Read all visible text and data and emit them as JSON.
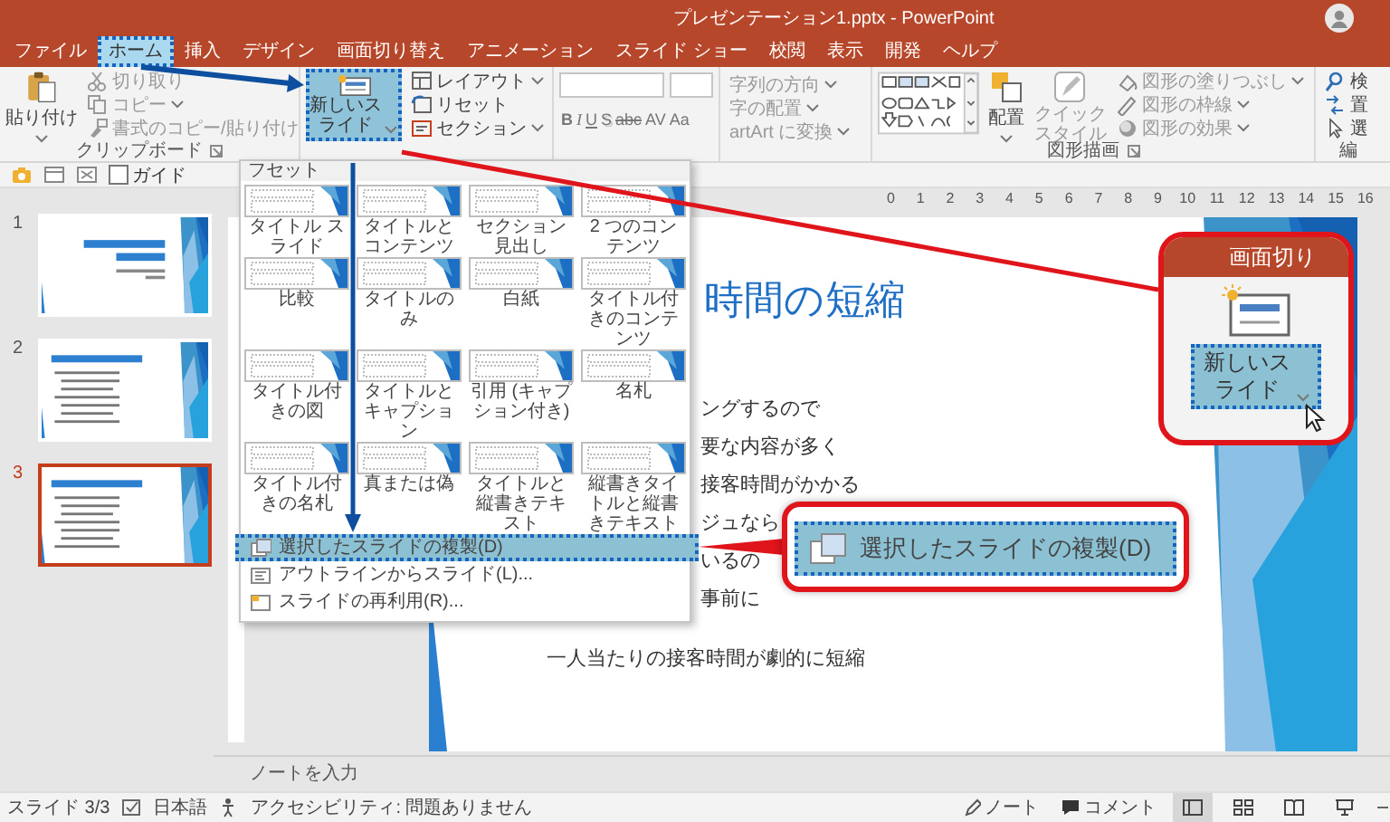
{
  "window": {
    "title": "プレゼンテーション1.pptx - PowerPoint"
  },
  "tabs": [
    {
      "label": "ファイル",
      "selected": false
    },
    {
      "label": "ホーム",
      "selected": true
    },
    {
      "label": "挿入",
      "selected": false
    },
    {
      "label": "デザイン",
      "selected": false
    },
    {
      "label": "画面切り替え",
      "selected": false
    },
    {
      "label": "アニメーション",
      "selected": false
    },
    {
      "label": "スライド ショー",
      "selected": false
    },
    {
      "label": "校閲",
      "selected": false
    },
    {
      "label": "表示",
      "selected": false
    },
    {
      "label": "開発",
      "selected": false
    },
    {
      "label": "ヘルプ",
      "selected": false
    }
  ],
  "ribbon": {
    "clipboard": {
      "paste": "貼り付け",
      "items": [
        "切り取り",
        "コピー",
        "書式のコピー/貼り付け"
      ],
      "label": "クリップボード"
    },
    "slides": {
      "new_slide": "新しいスライド",
      "items": [
        "レイアウト",
        "リセット",
        "セクション"
      ]
    },
    "font_buttons": [
      "B",
      "I",
      "U",
      "S",
      "abc",
      "AV",
      "Aa"
    ],
    "paragraph_items": [
      "字列の方向",
      "字の配置",
      "artArt に変換"
    ],
    "drawing": {
      "arrange": "配置",
      "quick_styles": "クイックスタイル",
      "items": [
        "図形の塗りつぶし",
        "図形の枠線",
        "図形の効果"
      ],
      "label": "図形描画"
    },
    "editing": {
      "items": [
        "検",
        "置",
        "選"
      ],
      "label": "編"
    }
  },
  "quick_access": {
    "guide": {
      "label": "ガイド",
      "checked": false
    }
  },
  "ruler": [
    "0",
    "1",
    "2",
    "3",
    "4",
    "5",
    "6",
    "7",
    "8",
    "9",
    "10",
    "11",
    "12",
    "13",
    "14",
    "15",
    "16"
  ],
  "thumbnails": [
    {
      "number": "1",
      "selected": false
    },
    {
      "number": "2",
      "selected": false
    },
    {
      "number": "3",
      "selected": true
    }
  ],
  "slide": {
    "title": "時間の短縮",
    "lines": [
      {
        "text": "ングするので",
        "kind": "clipped"
      },
      {
        "text": "要な内容が多く",
        "kind": "clipped"
      },
      {
        "text": "接客時間がかかる",
        "kind": "clipped"
      },
      {
        "text": "ジュなら",
        "kind": "clipped"
      },
      {
        "text": "いるの",
        "kind": "clipped"
      },
      {
        "text": "事前に",
        "kind": "clipped"
      },
      {
        "text": "一人当たりの接客時間が劇的に短縮",
        "kind": "full"
      }
    ]
  },
  "notes": {
    "placeholder": "ノートを入力"
  },
  "layout_menu": {
    "header": "フセット",
    "layouts": [
      "タイトル スライド",
      "タイトルとコンテンツ",
      "セクション見出し",
      "2 つのコンテンツ",
      "比較",
      "タイトルのみ",
      "白紙",
      "タイトル付きのコンテンツ",
      "タイトル付きの図",
      "タイトルとキャプション",
      "引用 (キャプション付き)",
      "名札",
      "タイトル付きの名札",
      "真または偽",
      "タイトルと縦書きテキスト",
      "縦書きタイトルと縦書きテキスト"
    ],
    "items": [
      {
        "label": "選択したスライドの複製(D)",
        "selected": true
      },
      {
        "label": "アウトラインからスライド(L)...",
        "selected": false
      },
      {
        "label": "スライドの再利用(R)...",
        "selected": false
      }
    ]
  },
  "zoom_callout": {
    "tab": "画面切り",
    "button": "新しいスライド"
  },
  "item_callout": {
    "label": "選択したスライドの複製(D)"
  },
  "status_bar": {
    "slide": "スライド 3/3",
    "language": "日本語",
    "accessibility": "アクセシビリティ: 問題ありません",
    "notes": "ノート",
    "comments": "コメント"
  }
}
